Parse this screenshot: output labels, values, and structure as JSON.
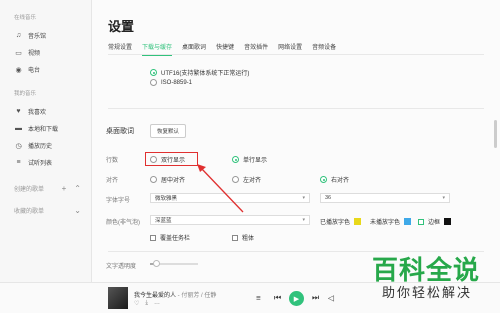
{
  "sidebar": {
    "online_group": "在线音乐",
    "online_items": [
      {
        "icon": "music-note-icon",
        "glyph": "♫",
        "label": "音乐馆"
      },
      {
        "icon": "video-icon",
        "glyph": "▭",
        "label": "视频"
      },
      {
        "icon": "radio-icon",
        "glyph": "◉",
        "label": "电台"
      }
    ],
    "my_group": "我的音乐",
    "my_items": [
      {
        "icon": "heart-icon",
        "glyph": "♥",
        "label": "我喜欢"
      },
      {
        "icon": "monitor-icon",
        "glyph": "▬",
        "label": "本地和下载"
      },
      {
        "icon": "history-icon",
        "glyph": "◷",
        "label": "播放历史"
      },
      {
        "icon": "list-icon",
        "glyph": "≡",
        "label": "试听列表"
      }
    ],
    "created_playlists": "创建的歌单",
    "collected_playlists": "收藏的歌单"
  },
  "settings": {
    "title": "设置",
    "tabs": [
      "常规设置",
      "下载与缓存",
      "桌面歌词",
      "快捷键",
      "音效插件",
      "网络设置",
      "音频设备"
    ],
    "active_tab": 1,
    "encoding_options": [
      "UTF16(支持繁体系统下正常运行)",
      "ISO-8859-1"
    ],
    "desktop_lyrics_label": "桌面歌词",
    "reset_button": "恢复默认",
    "rows_label": "行数",
    "rows_options": [
      "双行显示",
      "单行显示"
    ],
    "align_label": "对齐",
    "align_options": [
      "居中对齐",
      "左对齐",
      "右对齐"
    ],
    "font_label": "字体字号",
    "font_value": "微软雅黑",
    "font_size_value": "36",
    "color_label": "颜色(非气泡)",
    "color_value": "深蓝蓝",
    "played_label": "已播放字色",
    "unplayed_label": "未播放字色",
    "border_label": "边框",
    "played_color": "#e8d81a",
    "unplayed_color": "#3fa9e8",
    "border_color": "#111111",
    "overlay_taskbar": "覆盖任务栏",
    "bold": "粗体",
    "opacity_label": "文字透明度"
  },
  "player": {
    "song": "我今生最爱的人",
    "artist": " - 付丽芳 / 任静",
    "icons": [
      "♡",
      "⤓",
      "…"
    ]
  },
  "watermark": {
    "big": "百科全说",
    "small": "助你轻松解决"
  }
}
